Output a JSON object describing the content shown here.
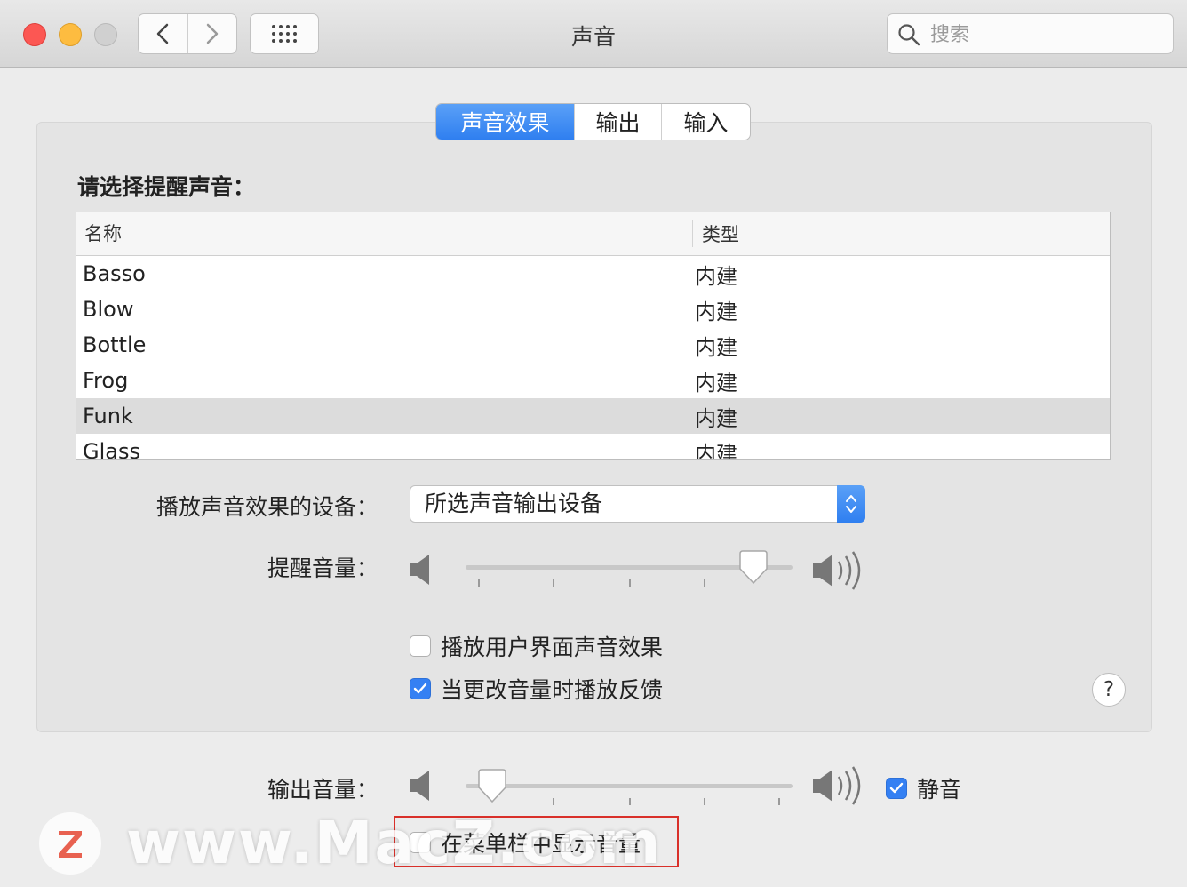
{
  "window": {
    "title": "声音",
    "search_placeholder": "搜索",
    "icons": [
      "back-icon",
      "forward-icon",
      "grid-icon",
      "search-icon"
    ]
  },
  "tabs": [
    {
      "label": "声音效果",
      "active": true
    },
    {
      "label": "输出",
      "active": false
    },
    {
      "label": "输入",
      "active": false
    }
  ],
  "sound_effects": {
    "prompt": "请选择提醒声音：",
    "table": {
      "headers": {
        "name": "名称",
        "type": "类型"
      },
      "rows": [
        {
          "name": "Basso",
          "type": "内建"
        },
        {
          "name": "Blow",
          "type": "内建"
        },
        {
          "name": "Bottle",
          "type": "内建"
        },
        {
          "name": "Frog",
          "type": "内建"
        },
        {
          "name": "Funk",
          "type": "内建",
          "selected": true
        },
        {
          "name": "Glass",
          "type": "内建"
        }
      ]
    },
    "device_label": "播放声音效果的设备：",
    "device_value": "所选声音输出设备",
    "alert_volume_label": "提醒音量：",
    "alert_volume_level": 0.92,
    "play_ui_sounds": {
      "label": "播放用户界面声音效果",
      "checked": false
    },
    "volume_feedback": {
      "label": "当更改音量时播放反馈",
      "checked": true
    }
  },
  "output": {
    "volume_label": "输出音量：",
    "volume_level": 0.04,
    "mute": {
      "label": "静音",
      "checked": true
    },
    "show_in_menubar": {
      "label": "在菜单栏中显示音量",
      "checked": false
    }
  },
  "watermark": {
    "text": "www.MacZ.com"
  },
  "colors": {
    "accent": "#3480f3",
    "highlight_box": "#d9302a"
  }
}
